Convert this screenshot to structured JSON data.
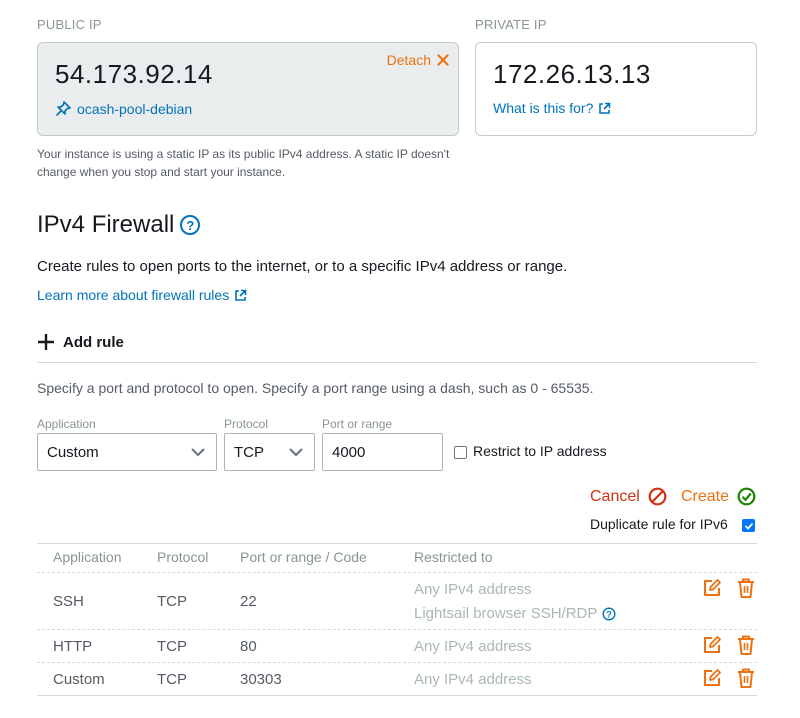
{
  "public_ip": {
    "section_label": "PUBLIC IP",
    "address": "54.173.92.14",
    "static_ip_name": "ocash-pool-debian",
    "detach_label": "Detach",
    "note": "Your instance is using a static IP as its public IPv4 address. A static IP doesn't change when you stop and start your instance."
  },
  "private_ip": {
    "section_label": "PRIVATE IP",
    "address": "172.26.13.13",
    "help_link": "What is this for?"
  },
  "firewall": {
    "title": "IPv4 Firewall",
    "help_glyph": "?",
    "description": "Create rules to open ports to the internet, or to a specific IPv4 address or range.",
    "learn_more": "Learn more about firewall rules",
    "add_rule_label": "Add rule",
    "port_hint": "Specify a port and protocol to open. Specify a port range using a dash, such as 0 - 65535."
  },
  "new_rule": {
    "application_label": "Application",
    "application_value": "Custom",
    "protocol_label": "Protocol",
    "protocol_value": "TCP",
    "port_label": "Port or range",
    "port_value": "4000",
    "restrict_label": "Restrict to IP address",
    "restrict_checked": false,
    "cancel_label": "Cancel",
    "create_label": "Create",
    "duplicate_label": "Duplicate rule for IPv6",
    "duplicate_checked": true
  },
  "rules_table": {
    "headers": [
      "Application",
      "Protocol",
      "Port or range / Code",
      "Restricted to"
    ],
    "rows": [
      {
        "application": "SSH",
        "protocol": "TCP",
        "port": "22",
        "restricted": "Any IPv4 address",
        "extra": "Lightsail browser SSH/RDP"
      },
      {
        "application": "HTTP",
        "protocol": "TCP",
        "port": "80",
        "restricted": "Any IPv4 address"
      },
      {
        "application": "Custom",
        "protocol": "TCP",
        "port": "30303",
        "restricted": "Any IPv4 address"
      }
    ]
  },
  "colors": {
    "accent_orange": "#ec7211",
    "link_blue": "#0073bb",
    "cancel_red": "#d13212",
    "create_green": "#1d8102"
  },
  "icons": {
    "pin": "pin-icon",
    "external": "external-link-icon",
    "close": "close-x-icon",
    "help": "help-circle-icon",
    "plus": "plus-icon",
    "chevron": "chevron-down-icon",
    "cancel": "cancel-circle-icon",
    "create": "check-circle-icon",
    "edit": "edit-icon",
    "delete": "trash-icon"
  }
}
